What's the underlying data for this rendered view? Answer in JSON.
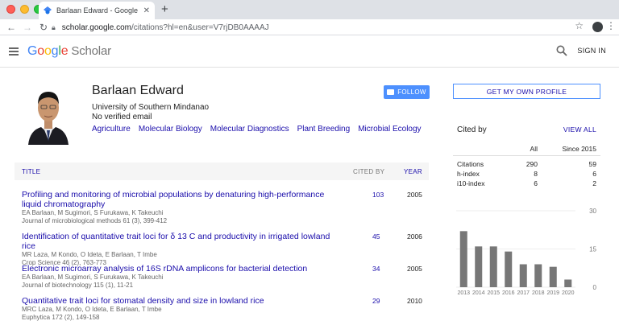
{
  "browser": {
    "tab_title": "Barlaan Edward - Google Scholar",
    "url_host": "scholar.google.com",
    "url_path": "/citations?hl=en&user=V7rjDB0AAAAJ"
  },
  "header": {
    "logo_google": [
      "G",
      "o",
      "o",
      "g",
      "l",
      "e"
    ],
    "logo_scholar": "Scholar",
    "signin_label": "SIGN IN"
  },
  "profile": {
    "name": "Barlaan Edward",
    "affiliation": "University of Southern Mindanao",
    "email": "No verified email",
    "interests": [
      "Agriculture",
      "Molecular Biology",
      "Molecular Diagnostics",
      "Plant Breeding",
      "Microbial Ecology"
    ],
    "follow_label": "FOLLOW"
  },
  "table": {
    "col_title": "TITLE",
    "col_cited": "CITED BY",
    "col_year": "YEAR",
    "rows": [
      {
        "title": "Profiling and monitoring of microbial populations by denaturing high-performance liquid chromatography",
        "authors": "EA Barlaan, M Sugimori, S Furukawa, K Takeuchi",
        "venue": "Journal of microbiological methods 61 (3), 399-412",
        "cited": "103",
        "year": "2005"
      },
      {
        "title": "Identification of quantitative trait loci for δ 13 C and productivity in irrigated lowland rice",
        "authors": "MR Laza, M Kondo, O Ideta, E Barlaan, T Imbe",
        "venue": "Crop Science 46 (2), 763-773",
        "cited": "45",
        "year": "2006"
      },
      {
        "title": "Electronic microarray analysis of 16S rDNA amplicons for bacterial detection",
        "authors": "EA Barlaan, M Sugimori, S Furukawa, K Takeuchi",
        "venue": "Journal of biotechnology 115 (1), 11-21",
        "cited": "34",
        "year": "2005"
      },
      {
        "title": "Quantitative trait loci for stomatal density and size in lowland rice",
        "authors": "MRC Laza, M Kondo, O Ideta, E Barlaan, T Imbe",
        "venue": "Euphytica 172 (2), 149-158",
        "cited": "29",
        "year": "2010"
      }
    ]
  },
  "sidebar": {
    "get_profile_label": "GET MY OWN PROFILE",
    "cited_by_label": "Cited by",
    "view_all_label": "VIEW ALL",
    "col_all": "All",
    "col_since": "Since 2015",
    "stats": [
      {
        "label": "Citations",
        "all": "290",
        "since": "59"
      },
      {
        "label": "h-index",
        "all": "8",
        "since": "6"
      },
      {
        "label": "i10-index",
        "all": "6",
        "since": "2"
      }
    ]
  },
  "chart_data": {
    "type": "bar",
    "categories": [
      "2013",
      "2014",
      "2015",
      "2016",
      "2017",
      "2018",
      "2019",
      "2020"
    ],
    "values": [
      22,
      16,
      16,
      14,
      9,
      9,
      8,
      3
    ],
    "ylim": [
      0,
      30
    ],
    "yticks": [
      0,
      15,
      30
    ],
    "bar_color": "#777777"
  },
  "colors": {
    "link": "#1a0dab",
    "accent": "#4d90fe"
  }
}
